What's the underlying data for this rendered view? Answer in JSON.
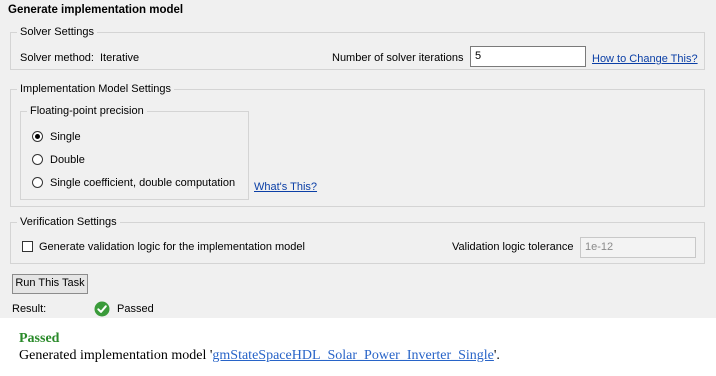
{
  "title": "Generate implementation model",
  "solver_settings": {
    "legend": "Solver Settings",
    "method_label": "Solver method:",
    "method_value": "Iterative",
    "iterations_label": "Number of solver iterations",
    "iterations_value": "5",
    "help_link": "How to Change This?"
  },
  "implementation_settings": {
    "legend": "Implementation Model Settings",
    "precision_legend": "Floating-point precision",
    "options": [
      {
        "label": "Single",
        "selected": true
      },
      {
        "label": "Double",
        "selected": false
      },
      {
        "label": "Single coefficient, double computation",
        "selected": false
      }
    ],
    "help_link": "What's This?"
  },
  "verification_settings": {
    "legend": "Verification Settings",
    "checkbox_label": "Generate validation logic for the implementation model",
    "checkbox_checked": false,
    "tolerance_label": "Validation logic tolerance",
    "tolerance_value": "1e-12"
  },
  "run_button_label": "Run This Task",
  "result": {
    "label": "Result:",
    "status": "Passed",
    "status_color": "#2a8a2a"
  },
  "report": {
    "heading": "Passed",
    "message_prefix": "Generated implementation model '",
    "model_name": "gmStateSpaceHDL_Solar_Power_Inverter_Single",
    "message_suffix": "'."
  }
}
